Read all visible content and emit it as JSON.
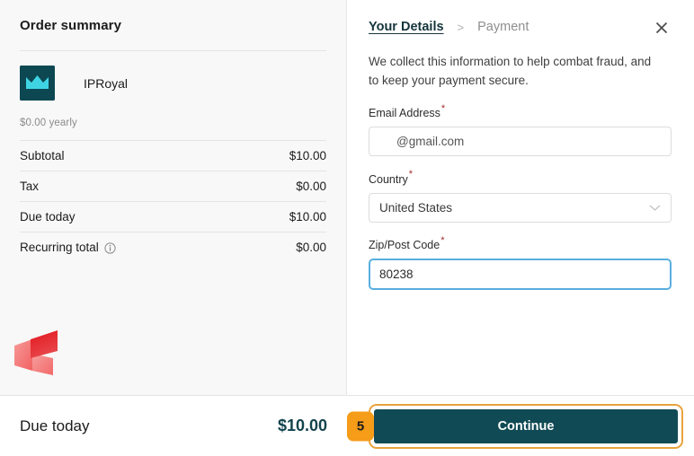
{
  "order_summary": {
    "title": "Order summary",
    "product_name": "IPRoyal",
    "plan_note": "$0.00 yearly",
    "rows": [
      {
        "label": "Subtotal",
        "value": "$10.00",
        "has_info": false
      },
      {
        "label": "Tax",
        "value": "$0.00",
        "has_info": false
      },
      {
        "label": "Due today",
        "value": "$10.00",
        "has_info": false
      },
      {
        "label": "Recurring total",
        "value": "$0.00",
        "has_info": true
      }
    ]
  },
  "details": {
    "breadcrumb": {
      "active": "Your Details",
      "separator": ">",
      "next": "Payment"
    },
    "close_label": "✕",
    "blurb": "We collect this information to help combat fraud, and to keep your payment secure.",
    "fields": [
      {
        "label": "Email Address",
        "required_marker": "*",
        "value": "@gmail.com",
        "type": "text",
        "focused": false
      },
      {
        "label": "Country",
        "required_marker": "*",
        "value": "United States",
        "type": "select",
        "focused": false
      },
      {
        "label": "Zip/Post Code",
        "required_marker": "*",
        "value": "80238",
        "type": "text",
        "focused": true
      }
    ]
  },
  "footer": {
    "due_label": "Due today",
    "due_value": "$10.00",
    "continue_label": "Continue",
    "step_badge": "5"
  },
  "colors": {
    "brand_teal": "#104a54",
    "accent_orange": "#f59c19",
    "ring_orange": "#e8a33d",
    "focus_blue": "#59aee0",
    "required_red": "#9e2a2a",
    "left_panel_bg": "#f8f8f8",
    "product_logo_bg": "#0d4852",
    "product_logo_mark": "#3fd4e4"
  }
}
